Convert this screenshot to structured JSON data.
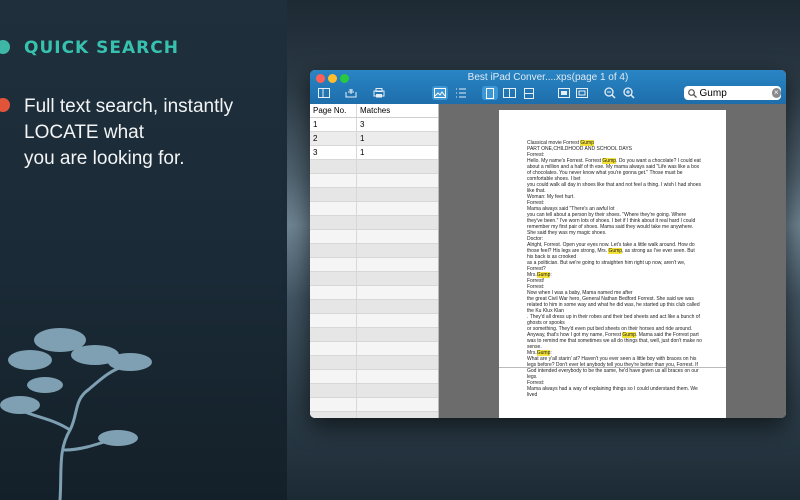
{
  "promo": {
    "heading": "QUICK SEARCH",
    "body_lines": [
      "Full text search, instantly",
      "LOCATE what",
      "you are looking for."
    ],
    "colors": {
      "heading": "#37c2b0",
      "dot1": "#3fb7a6",
      "dot2": "#e2543a"
    }
  },
  "window": {
    "title": "Best iPad Conver....xps(page 1 of 4)",
    "toolbar_icons": [
      "sidebar-icon",
      "tray-icon",
      "print-icon",
      "image-view-icon",
      "list-view-icon",
      "single-page-icon",
      "book-icon",
      "scroll-icon",
      "fit-width-icon",
      "fit-page-icon",
      "zoom-out-icon",
      "zoom-in-icon"
    ],
    "search": {
      "value": "Gump",
      "icon": "search-icon"
    }
  },
  "table": {
    "headers": [
      "Page No.",
      "Matches"
    ],
    "rows": [
      {
        "page": "1",
        "matches": "3"
      },
      {
        "page": "2",
        "matches": "1"
      },
      {
        "page": "3",
        "matches": "1"
      }
    ]
  },
  "document": {
    "lines": [
      "Classical movie Forrest Gump",
      "PART ONE,CHILDHOOD AND SCHOOL DAYS",
      "Forrest:",
      "Hello. My name's Forrest. Forrest Gump. Do you want a chocolate? I could eat about a million and a half of th   ese. My mama always said \"Life was like a box of chocolates. You never know what you're gonna get.\" Those must be comfortable shoes. I bet",
      "you could walk all day in shoes like that and not feel a thing. I wish I had shoes like that.",
      "Woman: My feet hurt.",
      "Forrest:",
      "Mama always said \"There's an awful lot",
      "you can tell about a person by their shoes. \"Where they're going. Where they've been.\" I've worn lots of shoes. I bet if I think about it real hard I could remember my first pair of shoes. Mama said they would take me anywhere. She said they was my magic shoes.",
      "Doctor:",
      "Alright, Forrest. Open your eyes now. Let's take a little walk around. How do those feel? His legs are strong, Mrs. Gump, as strong as I've ever seen. But his back is as crooked",
      "as a politician. But we're going to straighten him right up now, aren't we, Forrest?",
      "Mrs.Gump:",
      "Forrest!",
      "Forrest:",
      "Now when I was a baby, Mama named me after",
      "the great Civil War hero, General Nathan Bedford Forrest. She said we was related to him in some way and what he did was, he started up this club called the Ku Klux Klan",
      ". They'd all dress up in their robes and their bed sheets and act like a bunch of ghosts or spooks",
      "or something. They'd even put bed sheets on their horses and ride around. Anyway, that's how I got my name, Forrest Gump. Mama said the Forrest part was to remind me that sometimes we all do things that, well, just don't make no sense.",
      "Mrs.Gump:",
      "What are y'all starin' at? Haven't you ever seen a little boy with braces on his legs before? Don't ever let anybody tell you they're better than you, Forrest. If God intended everybody to be the same, he'd have given us all braces on our legs.",
      "Forrest:",
      "Mama always had a way of explaining things so I could understand them. We lived"
    ]
  }
}
